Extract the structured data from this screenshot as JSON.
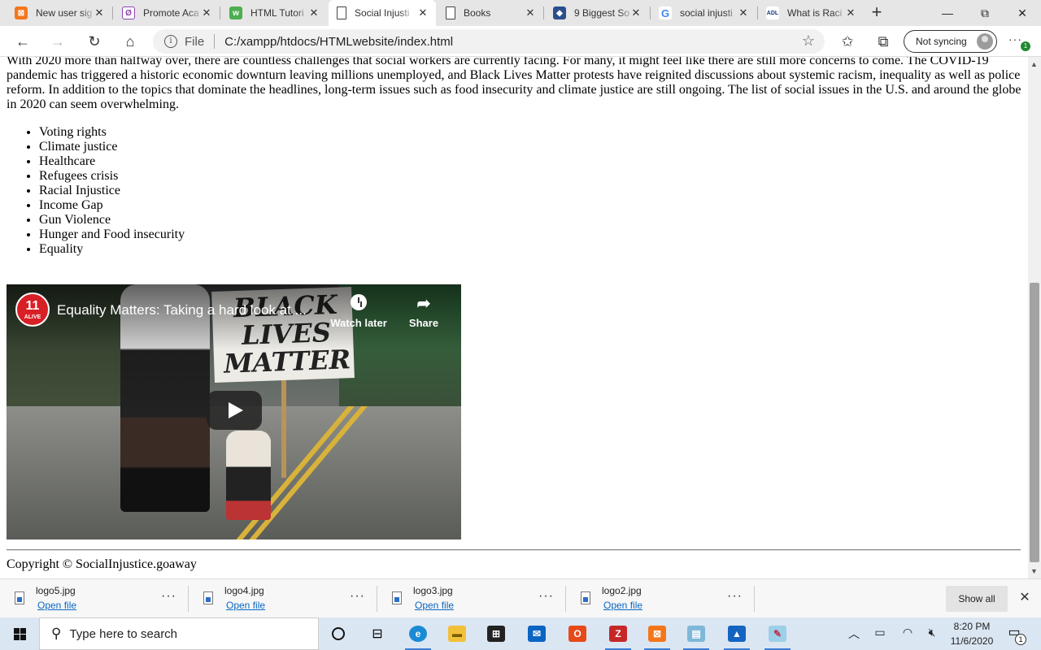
{
  "browser": {
    "tabs": [
      {
        "title": "New user sig",
        "icon": "xampp-icon",
        "color": "#f5761a"
      },
      {
        "title": "Promote Aca",
        "icon": "promote-icon",
        "color": "#8e44ad"
      },
      {
        "title": "HTML Tutori",
        "icon": "w3schools-icon",
        "color": "#4caf50"
      },
      {
        "title": "Social Injusti",
        "icon": "page-icon",
        "color": "#ffffff"
      },
      {
        "title": "Books",
        "icon": "page-icon",
        "color": "#ffffff"
      },
      {
        "title": "9 Biggest So",
        "icon": "shield-icon",
        "color": "#2a4f8c"
      },
      {
        "title": "social injusti",
        "icon": "google-icon",
        "color": "#ffffff"
      },
      {
        "title": "What is Raci",
        "icon": "adl-icon",
        "color": "#1b3b7a"
      }
    ],
    "active_tab": 3,
    "address": {
      "scheme_label": "File",
      "url": "C:/xampp/htdocs/HTMLwebsite/index.html"
    },
    "sync_label": "Not syncing",
    "more_badge": "1"
  },
  "page": {
    "intro": "With 2020 more than halfway over, there are countless challenges that social workers are currently facing. For many, it might feel like there are still more concerns to come. The COVID-19 pandemic has triggered a historic economic downturn leaving millions unemployed, and Black Lives Matter protests have reignited discussions about systemic racism, inequality as well as police reform. In addition to the topics that dominate the headlines, long-term issues such as food insecurity and climate justice are still ongoing. The list of social issues in the U.S. and around the globe in 2020 can seem overwhelming.",
    "issues": [
      "Voting rights",
      "Climate justice",
      "Healthcare",
      "Refugees crisis",
      "Racial Injustice",
      "Income Gap",
      "Gun Violence",
      "Hunger and Food insecurity",
      "Equality"
    ],
    "video": {
      "title": "Equality Matters: Taking a hard look at ...",
      "channel_badge_number": "11",
      "channel_badge_text": "ALIVE",
      "sign_text": "BLACK LIVES MATTER",
      "watch_later_label": "Watch later",
      "share_label": "Share"
    },
    "footer": "Copyright © SocialInjustice.goaway"
  },
  "downloads": {
    "items": [
      {
        "file": "logo5.jpg",
        "action": "Open file"
      },
      {
        "file": "logo4.jpg",
        "action": "Open file"
      },
      {
        "file": "logo3.jpg",
        "action": "Open file"
      },
      {
        "file": "logo2.jpg",
        "action": "Open file"
      }
    ],
    "show_all_label": "Show all"
  },
  "taskbar": {
    "search_placeholder": "Type here to search",
    "time": "8:20 PM",
    "date": "11/6/2020",
    "notification_count": "1"
  }
}
